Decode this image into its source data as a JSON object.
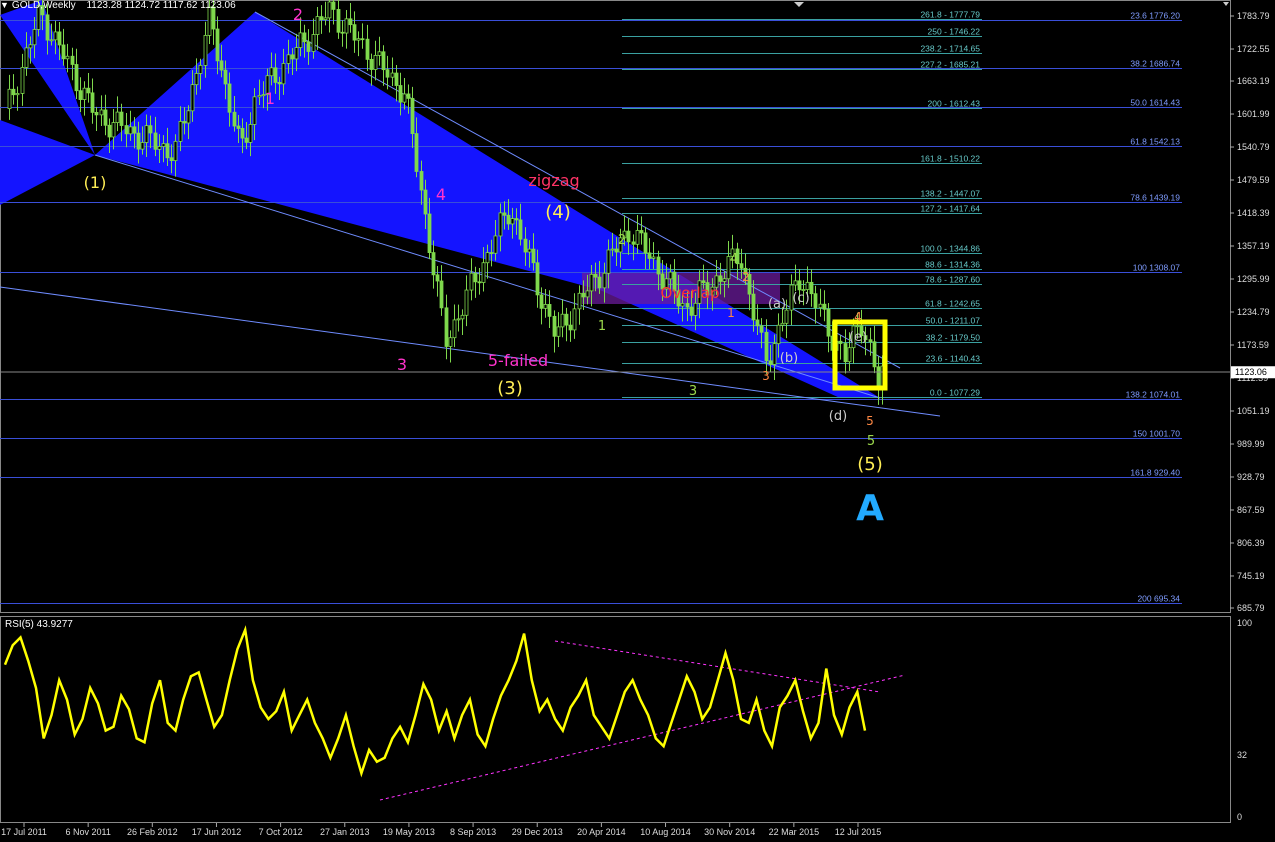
{
  "header": {
    "symbol": "GOLD,Weekly",
    "ohlc": "1123.28 1124.72 1117.62 1123.06"
  },
  "rsi_header": "RSI(5) 43.9277",
  "colors": {
    "background": "#000000",
    "grid_line": "#3a4fd8",
    "fib_right": "#5a78ff",
    "fib_left": "#3aa0a0",
    "candle": "#7fd84c",
    "channel_fill": "#1414ff",
    "rsi_line": "#ffff00",
    "trend_pink": "#ff33ff",
    "highlight_box": "#ffff00",
    "overlap_box": "#6a1b9a"
  },
  "price_axis": {
    "ticks": [
      "1783.79",
      "1722.55",
      "1663.19",
      "1601.99",
      "1540.79",
      "1479.59",
      "1418.39",
      "1357.19",
      "1295.99",
      "1234.79",
      "1173.59",
      "1112.39",
      "1051.19",
      "989.99",
      "928.79",
      "867.59",
      "806.39",
      "745.19",
      "685.79"
    ],
    "current_price": "1123.06"
  },
  "rsi_axis": {
    "ticks": [
      "100",
      "32",
      "0"
    ]
  },
  "time_axis": {
    "labels": [
      "17 Jul 2011",
      "6 Nov 2011",
      "26 Feb 2012",
      "17 Jun 2012",
      "7 Oct 2012",
      "27 Jan 2013",
      "19 May 2013",
      "8 Sep 2013",
      "29 Dec 2013",
      "20 Apr 2014",
      "10 Aug 2014",
      "30 Nov 2014",
      "22 Mar 2015",
      "12 Jul 2015"
    ]
  },
  "chart_data": [
    {
      "type": "candlestick",
      "title": "GOLD,Weekly",
      "ylim": [
        680,
        1800
      ],
      "x_range": [
        "17 Jul 2011",
        "12 Jul 2015"
      ],
      "swing_points": [
        {
          "date": "17 Jul 2011",
          "price": 1600
        },
        {
          "date": "Sep 2011",
          "price": 1790
        },
        {
          "date": "6 Nov 2011",
          "price": 1600
        },
        {
          "date": "26 Dec 2011",
          "price": 1530
        },
        {
          "date": "Feb 2012",
          "price": 1780
        },
        {
          "date": "May 2012",
          "price": 1530
        },
        {
          "date": "17 Jun 2012",
          "price": 1630
        },
        {
          "date": "7 Oct 2012",
          "price": 1795
        },
        {
          "date": "Jan 2013",
          "price": 1640
        },
        {
          "date": "19 May 2013",
          "price": 1180
        },
        {
          "date": "Aug 2013",
          "price": 1430
        },
        {
          "date": "Dec 2013",
          "price": 1190
        },
        {
          "date": "Mar 2014",
          "price": 1390
        },
        {
          "date": "Jun 2014",
          "price": 1240
        },
        {
          "date": "Jul 2014",
          "price": 1340
        },
        {
          "date": "Nov 2014",
          "price": 1140
        },
        {
          "date": "Jan 2015",
          "price": 1305
        },
        {
          "date": "Mar 2015",
          "price": 1145
        },
        {
          "date": "May 2015",
          "price": 1230
        },
        {
          "date": "Jul 2015",
          "price": 1080
        },
        {
          "date": "Aug 2015",
          "price": 1170
        },
        {
          "date": "12 Jul 2015",
          "price": 1123
        }
      ],
      "fib_left": [
        {
          "label": "261.8 - 1777.79",
          "price": 1777.79
        },
        {
          "label": "250 - 1746.22",
          "price": 1746.22
        },
        {
          "label": "238.2 - 1714.65",
          "price": 1714.65
        },
        {
          "label": "227.2 - 1685.21",
          "price": 1685.21
        },
        {
          "label": "200 - 1612.43",
          "price": 1612.43
        },
        {
          "label": "161.8 - 1510.22",
          "price": 1510.22
        },
        {
          "label": "138.2 - 1447.07",
          "price": 1447.07
        },
        {
          "label": "127.2 - 1417.64",
          "price": 1417.64
        },
        {
          "label": "100.0 - 1344.86",
          "price": 1344.86
        },
        {
          "label": "88.6 - 1314.36",
          "price": 1314.36
        },
        {
          "label": "78.6 - 1287.60",
          "price": 1287.6
        },
        {
          "label": "61.8 - 1242.65",
          "price": 1242.65
        },
        {
          "label": "50.0 - 1211.07",
          "price": 1211.07
        },
        {
          "label": "38.2 - 1179.50",
          "price": 1179.5
        },
        {
          "label": "23.6 - 1140.43",
          "price": 1140.43
        },
        {
          "label": "0.0 - 1077.29",
          "price": 1077.29
        }
      ],
      "fib_right": [
        {
          "label": "23.6 1776.20",
          "price": 1776.2
        },
        {
          "label": "38.2 1686.74",
          "price": 1686.74
        },
        {
          "label": "50.0 1614.43",
          "price": 1614.43
        },
        {
          "label": "61.8 1542.13",
          "price": 1542.13
        },
        {
          "label": "78.6 1439.19",
          "price": 1439.19
        },
        {
          "label": "100 1308.07",
          "price": 1308.07
        },
        {
          "label": "138.2 1074.01",
          "price": 1074.01
        },
        {
          "label": "150 1001.70",
          "price": 1001.7
        },
        {
          "label": "161.8 929.40",
          "price": 929.4
        },
        {
          "label": "200 695.34",
          "price": 695.34
        }
      ],
      "wave_labels": [
        {
          "text": "2",
          "color": "#ff33cc"
        },
        {
          "text": "1",
          "color": "#ff33cc"
        },
        {
          "text": "(1)",
          "color": "#ffee55"
        },
        {
          "text": "4",
          "color": "#ff33cc"
        },
        {
          "text": "3",
          "color": "#ff33cc"
        },
        {
          "text": "5-failed",
          "color": "#ff33cc"
        },
        {
          "text": "(3)",
          "color": "#ffee55"
        },
        {
          "text": "zigzag",
          "color": "#ff3366"
        },
        {
          "text": "(4)",
          "color": "#ffee55"
        },
        {
          "text": "2",
          "color": "#9bd84c"
        },
        {
          "text": "1",
          "color": "#9bd84c"
        },
        {
          "text": "3",
          "color": "#9bd84c"
        },
        {
          "text": "4",
          "color": "#9bd84c"
        },
        {
          "text": "2",
          "color": "#ff8844"
        },
        {
          "text": "1",
          "color": "#ff8844"
        },
        {
          "text": "3",
          "color": "#ff8844"
        },
        {
          "text": "4",
          "color": "#ff8844"
        },
        {
          "text": "5",
          "color": "#ff8844"
        },
        {
          "text": "5",
          "color": "#9bd84c"
        },
        {
          "text": "(a)",
          "color": "#cccccc"
        },
        {
          "text": "(b)",
          "color": "#cccccc"
        },
        {
          "text": "(c)",
          "color": "#cccccc"
        },
        {
          "text": "(d)",
          "color": "#cccccc"
        },
        {
          "text": "(e)",
          "color": "#cccccc"
        },
        {
          "text": "Overlap",
          "color": "#ff3333"
        },
        {
          "text": "(5)",
          "color": "#ffee55"
        },
        {
          "text": "A",
          "color": "#22aaff"
        }
      ]
    },
    {
      "type": "line",
      "title": "RSI(5) 43.9277",
      "ylim": [
        0,
        100
      ],
      "series": [
        {
          "name": "RSI(5)",
          "values": [
            78,
            88,
            92,
            80,
            66,
            40,
            52,
            70,
            60,
            42,
            50,
            66,
            58,
            44,
            46,
            62,
            55,
            40,
            38,
            58,
            70,
            48,
            44,
            60,
            72,
            74,
            60,
            46,
            52,
            70,
            86,
            96,
            70,
            56,
            50,
            54,
            64,
            44,
            52,
            60,
            48,
            40,
            30,
            40,
            52,
            36,
            22,
            34,
            28,
            30,
            40,
            46,
            38,
            52,
            68,
            60,
            44,
            54,
            40,
            52,
            60,
            42,
            36,
            50,
            62,
            70,
            80,
            94,
            70,
            54,
            60,
            50,
            44,
            56,
            62,
            70,
            52,
            46,
            40,
            52,
            64,
            70,
            60,
            52,
            40,
            36,
            48,
            60,
            72,
            64,
            50,
            56,
            70,
            84,
            70,
            50,
            48,
            60,
            44,
            36,
            56,
            62,
            70,
            54,
            40,
            48,
            76,
            52,
            42,
            56,
            64,
            44
          ]
        }
      ],
      "value": 43.9277
    }
  ]
}
